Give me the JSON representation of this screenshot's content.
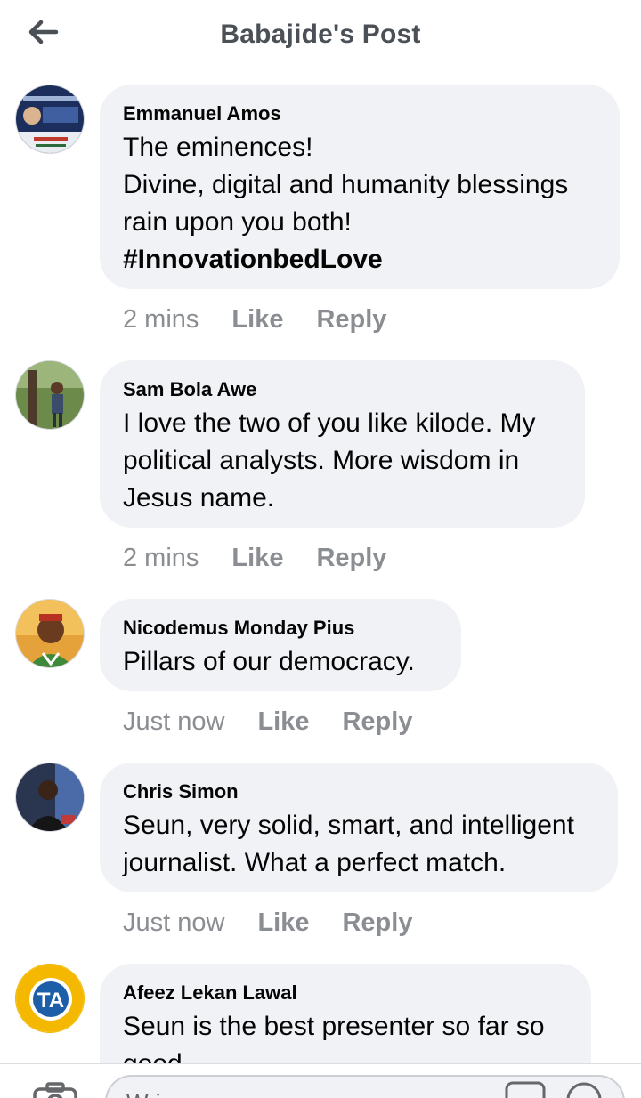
{
  "header": {
    "title": "Babajide's Post",
    "back_icon": "arrow-left-icon"
  },
  "comments": [
    {
      "author": "Emmanuel Amos",
      "lines": [
        "The eminences!",
        "Divine, digital and humanity blessings rain upon you both!"
      ],
      "tag": "#InnovationbedLove",
      "time": "2 mins",
      "like": "Like",
      "reply": "Reply"
    },
    {
      "author": "Sam Bola Awe",
      "lines": [
        "I love the two of you like kilode. My political analysts. More wisdom in Jesus name."
      ],
      "time": "2 mins",
      "like": "Like",
      "reply": "Reply"
    },
    {
      "author": "Nicodemus Monday Pius",
      "lines": [
        "Pillars of our democracy."
      ],
      "time": "Just now",
      "like": "Like",
      "reply": "Reply"
    },
    {
      "author": "Chris Simon",
      "lines": [
        "Seun, very solid, smart, and intelligent journalist. What a perfect match."
      ],
      "time": "Just now",
      "like": "Like",
      "reply": "Reply"
    },
    {
      "author": "Afeez Lekan Lawal",
      "lines": [
        "Seun is the best presenter so far so good."
      ]
    }
  ],
  "composer": {
    "camera_icon": "camera-icon",
    "placeholder": "Wri",
    "gif_icon": "gif-icon",
    "emoji_icon": "emoji-icon"
  },
  "colors": {
    "bubble": "#f0f2f5",
    "meta": "#8a8d91",
    "header_title": "#4b4f56"
  }
}
